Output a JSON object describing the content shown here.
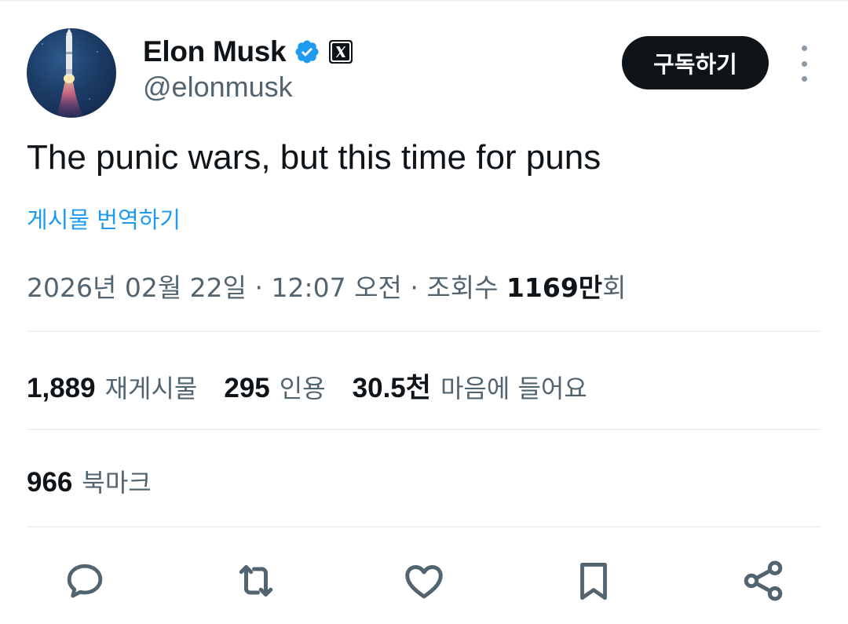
{
  "author": {
    "name": "Elon Musk",
    "handle": "@elonmusk",
    "avatar_icon": "rocket-launch-avatar",
    "verified_color": "#1d9bf0"
  },
  "header": {
    "subscribe_label": "구독하기",
    "more_icon": "more-vertical-icon"
  },
  "tweet": {
    "text": "The punic wars, but this time for puns",
    "translate_label": "게시물 번역하기"
  },
  "meta": {
    "date": "2026년 02월 22일",
    "separator": "·",
    "time": "12:07 오전",
    "views_label": "조회수",
    "views_number": "1169",
    "views_unit": "만",
    "views_suffix": "회"
  },
  "stats": {
    "reposts": {
      "value": "1,889",
      "label": "재게시물"
    },
    "quotes": {
      "value": "295",
      "label": "인용"
    },
    "likes": {
      "value": "30.5천",
      "label": "마음에 들어요"
    },
    "bookmarks": {
      "value": "966",
      "label": "북마크"
    }
  },
  "actions": [
    "reply-icon",
    "repost-icon",
    "like-icon",
    "bookmark-icon",
    "share-icon"
  ],
  "colors": {
    "text_primary": "#0f1419",
    "text_secondary": "#536471",
    "accent": "#1d9bf0",
    "divider": "#eff3f4"
  }
}
